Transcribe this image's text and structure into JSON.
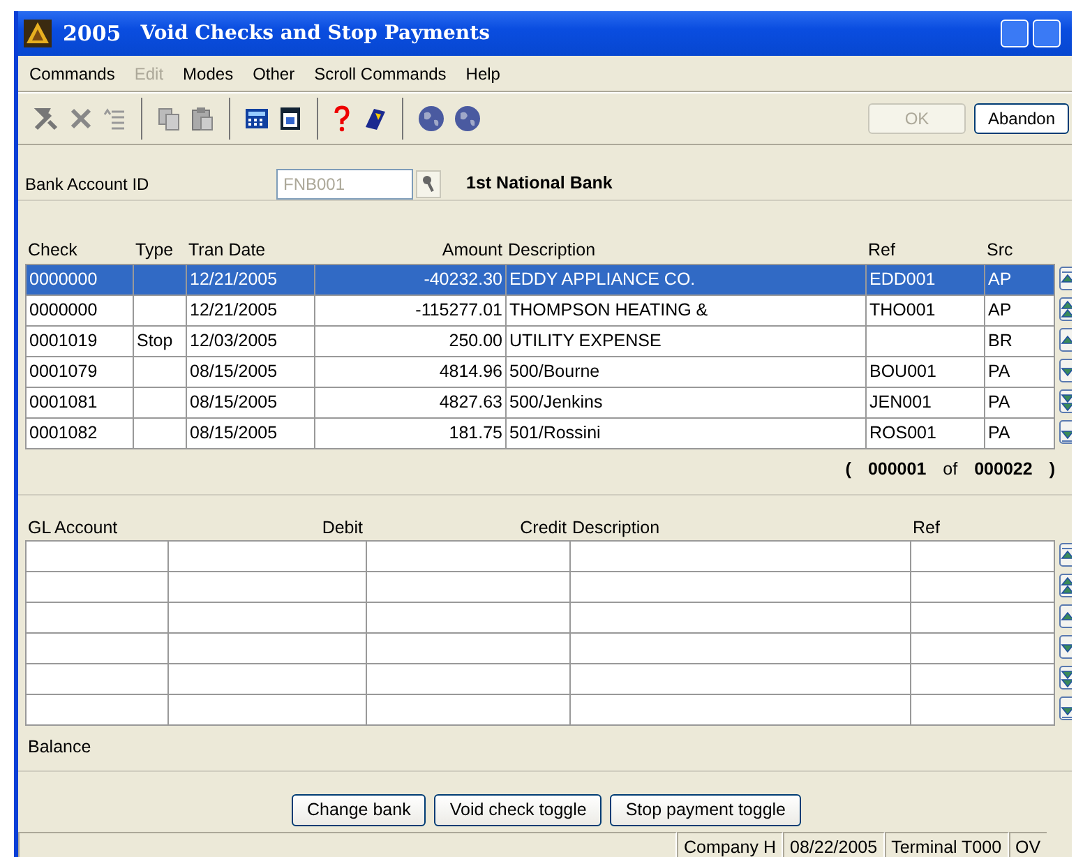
{
  "window": {
    "number": "2005",
    "title": "Void Checks and Stop Payments"
  },
  "menu": [
    {
      "label": "Commands",
      "disabled": false
    },
    {
      "label": "Edit",
      "disabled": true
    },
    {
      "label": "Modes",
      "disabled": false
    },
    {
      "label": "Other",
      "disabled": false
    },
    {
      "label": "Scroll Commands",
      "disabled": false
    },
    {
      "label": "Help",
      "disabled": false
    }
  ],
  "toolbar_buttons": [
    {
      "label": "OK",
      "disabled": true
    },
    {
      "label": "Abandon",
      "disabled": false
    }
  ],
  "bank": {
    "label": "Bank Account ID",
    "value": "FNB001",
    "name": "1st National Bank"
  },
  "checks": {
    "columns": [
      "Check",
      "Type",
      "Tran Date",
      "Amount",
      "Description",
      "Ref",
      "Src"
    ],
    "rows": [
      {
        "cells": [
          "0000000",
          "",
          "12/21/2005",
          "-40232.30",
          "EDDY APPLIANCE CO.",
          "EDD001",
          "AP"
        ],
        "selected": true
      },
      {
        "cells": [
          "0000000",
          "",
          "12/21/2005",
          "-115277.01",
          "THOMPSON HEATING &",
          "THO001",
          "AP"
        ],
        "selected": false
      },
      {
        "cells": [
          "0001019",
          "Stop",
          "12/03/2005",
          "250.00",
          "UTILITY EXPENSE",
          "",
          "BR"
        ],
        "selected": false
      },
      {
        "cells": [
          "0001079",
          "",
          "08/15/2005",
          "4814.96",
          "500/Bourne",
          "BOU001",
          "PA"
        ],
        "selected": false
      },
      {
        "cells": [
          "0001081",
          "",
          "08/15/2005",
          "4827.63",
          "500/Jenkins",
          "JEN001",
          "PA"
        ],
        "selected": false
      },
      {
        "cells": [
          "0001082",
          "",
          "08/15/2005",
          "181.75",
          "501/Rossini",
          "ROS001",
          "PA"
        ],
        "selected": false
      }
    ],
    "counter": {
      "open": "(",
      "current": "000001",
      "of": "of",
      "total": "000022",
      "close": ")"
    }
  },
  "gl": {
    "columns": [
      "GL Account",
      "Debit",
      "Credit",
      "Description",
      "Ref"
    ]
  },
  "balance_label": "Balance",
  "actions": [
    "Change bank",
    "Void check toggle",
    "Stop payment toggle"
  ],
  "status_bar": [
    "Company H",
    "08/22/2005",
    "Terminal T000",
    "OV"
  ]
}
